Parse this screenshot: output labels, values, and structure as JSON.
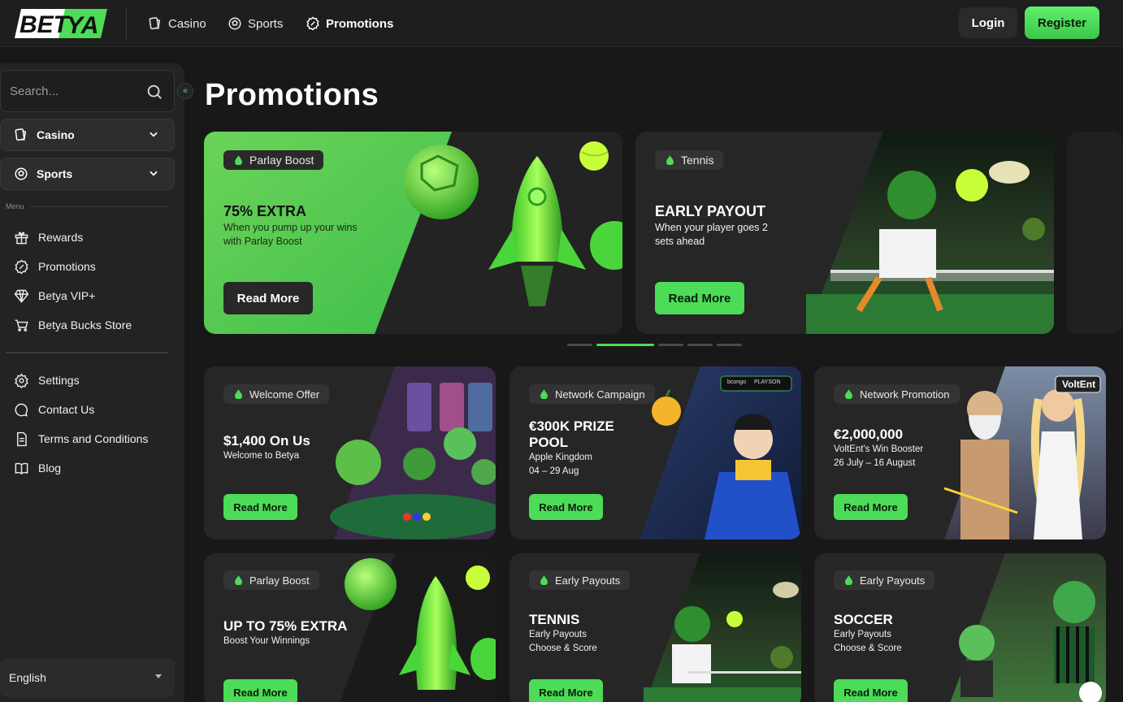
{
  "header": {
    "logo_text": "BETYA",
    "nav": [
      {
        "label": "Casino",
        "icon": "casino-icon"
      },
      {
        "label": "Sports",
        "icon": "soccer-ball-icon"
      },
      {
        "label": "Promotions",
        "icon": "percent-badge-icon",
        "active": true
      }
    ],
    "login_label": "Login",
    "register_label": "Register"
  },
  "sidebar": {
    "search_placeholder": "Search...",
    "dropdowns": [
      {
        "label": "Casino",
        "icon": "casino-icon"
      },
      {
        "label": "Sports",
        "icon": "soccer-ball-icon"
      }
    ],
    "menu_label": "Menu",
    "items": [
      {
        "label": "Rewards",
        "icon": "gift-icon"
      },
      {
        "label": "Promotions",
        "icon": "percent-badge-icon"
      },
      {
        "label": "Betya VIP+",
        "icon": "diamond-icon"
      },
      {
        "label": "Betya Bucks Store",
        "icon": "cart-icon"
      }
    ],
    "items2": [
      {
        "label": "Settings",
        "icon": "gear-icon"
      },
      {
        "label": "Contact Us",
        "icon": "chat-icon"
      },
      {
        "label": "Terms and Conditions",
        "icon": "document-icon"
      },
      {
        "label": "Blog",
        "icon": "book-icon"
      }
    ],
    "language": "English"
  },
  "main": {
    "title": "Promotions",
    "carousel": [
      {
        "tag": "Parlay Boost",
        "title": "75% EXTRA",
        "sub": "When you pump up your wins with Parlay Boost",
        "button": "Read More"
      },
      {
        "tag": "Tennis",
        "title": "EARLY PAYOUT",
        "sub": "When your player goes 2 sets ahead",
        "button": "Read More"
      }
    ],
    "carousel_dots": 6,
    "carousel_active_dot": 1,
    "cards": [
      {
        "tag": "Welcome Offer",
        "title": "$1,400 On Us",
        "sub": "Welcome to Betya",
        "button": "Read More"
      },
      {
        "tag": "Network Campaign",
        "title": "€300K PRIZE POOL",
        "sub": "Apple Kingdom\n04 – 29 Aug",
        "button": "Read More",
        "badge_left": "bcongo",
        "badge_right": "PLAYSON"
      },
      {
        "tag": "Network Promotion",
        "title": "€2,000,000",
        "sub": "VoltEnt's Win Booster\n26 July – 16 August",
        "button": "Read More",
        "badge": "VoltEnt"
      },
      {
        "tag": "Parlay Boost",
        "title": "UP TO 75% EXTRA",
        "sub": "Boost Your Winnings",
        "button": "Read More"
      },
      {
        "tag": "Early Payouts",
        "title": "TENNIS",
        "sub": "Early Payouts\nChoose & Score",
        "button": "Read More"
      },
      {
        "tag": "Early Payouts",
        "title": "SOCCER",
        "sub": "Early Payouts\nChoose & Score",
        "button": "Read More"
      }
    ]
  },
  "colors": {
    "accent": "#4cdc58",
    "bg": "#181818",
    "card": "#262626"
  }
}
